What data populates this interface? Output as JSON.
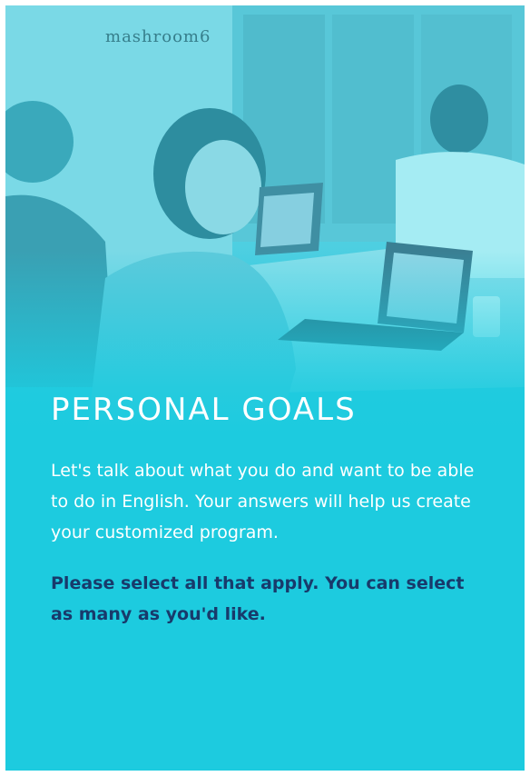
{
  "hero": {
    "brand_logo": "mashroom6"
  },
  "heading": {
    "title": "PERSONAL GOALS"
  },
  "body": {
    "intro": "Let's talk about what you do and want to be able to do in English.  Your answers will help us create your customized program.",
    "instruction": "Please select all that apply. You can select as many as you'd like."
  },
  "colors": {
    "background": "#1dcbdf",
    "title_text": "#ffffff",
    "instruction_text": "#183a6b"
  }
}
